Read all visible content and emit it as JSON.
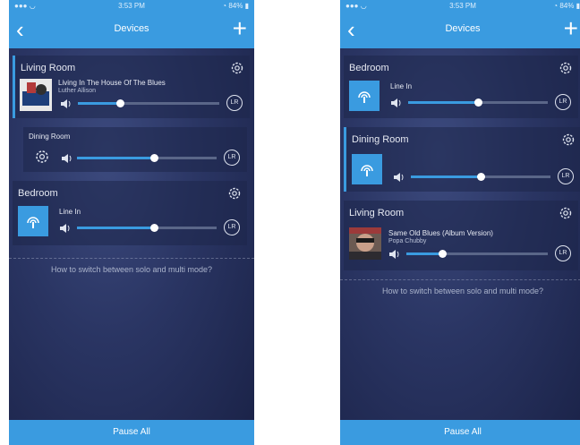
{
  "status": {
    "time": "3:53 PM",
    "battery": "84%"
  },
  "nav": {
    "title": "Devices",
    "back": "‹",
    "add": "+"
  },
  "help_text": "How to switch between solo and multi mode?",
  "pause_all": "Pause All",
  "left": {
    "living": {
      "name": "Living Room",
      "track": "Living In The House Of The Blues",
      "artist": "Luther Allison",
      "volume": 0.3,
      "channel": "LR"
    },
    "dining": {
      "name": "Dining Room",
      "volume": 0.5,
      "channel": "LR"
    },
    "bedroom": {
      "name": "Bedroom",
      "source": "Line In",
      "volume": 0.55,
      "channel": "LR"
    }
  },
  "right": {
    "bedroom": {
      "name": "Bedroom",
      "source": "Line In",
      "volume": 0.5,
      "channel": "LR"
    },
    "dining": {
      "name": "Dining Room",
      "volume": 0.5,
      "channel": "LR"
    },
    "living": {
      "name": "Living Room",
      "track": "Same Old Blues (Album Version)",
      "artist": "Popa Chubby",
      "volume": 0.25,
      "channel": "LR"
    }
  },
  "colors": {
    "accent": "#3a9be0",
    "background": "#2a3563"
  },
  "icons": [
    "back-chevron-icon",
    "plus-icon",
    "gear-icon",
    "speaker-icon",
    "line-in-icon",
    "lr-channel-icon"
  ]
}
